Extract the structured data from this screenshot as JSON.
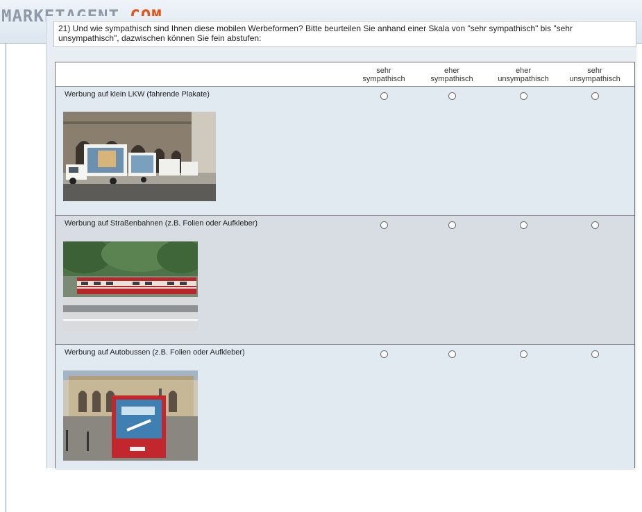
{
  "header": {
    "logo_main": "MARKETAGENT",
    "logo_accent": ".COM"
  },
  "question": {
    "text": "21) Und wie sympathisch sind Ihnen diese mobilen Werbeformen? Bitte beurteilen Sie anhand einer Skala von \"sehr sympathisch\" bis \"sehr unsympathisch\", dazwischen können Sie fein abstufen:"
  },
  "scale": {
    "columns": [
      {
        "line1": "sehr",
        "line2": "sympathisch"
      },
      {
        "line1": "eher",
        "line2": "sympathisch"
      },
      {
        "line1": "eher",
        "line2": "unsympathisch"
      },
      {
        "line1": "sehr",
        "line2": "unsympathisch"
      }
    ]
  },
  "items": [
    {
      "label": "Werbung auf klein LKW (fahrende Plakate)"
    },
    {
      "label": "Werbung auf Straßenbahnen (z.B. Folien oder Aufkleber)"
    },
    {
      "label": "Werbung auf Autobussen (z.B. Folien oder Aufkleber)"
    }
  ],
  "colors": {
    "accent": "#e3541a",
    "logo_gray": "#8e9aa7",
    "row_light": "#e2eaf1",
    "row_dark": "#d7dde2"
  }
}
